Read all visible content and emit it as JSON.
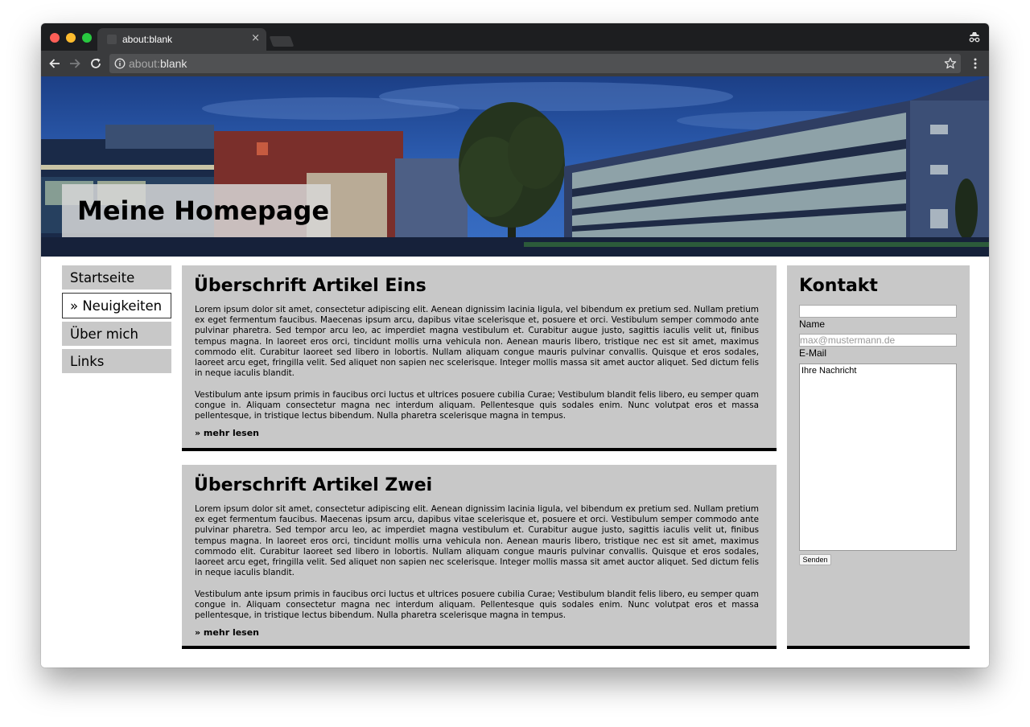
{
  "browser": {
    "tab_title": "about:blank",
    "tab_close": "×",
    "url_prefix": "about:",
    "url_rest": "blank"
  },
  "header": {
    "title": "Meine Homepage"
  },
  "nav": {
    "items": [
      {
        "label": "Startseite"
      },
      {
        "label": "» Neuigkeiten"
      },
      {
        "label": "Über mich"
      },
      {
        "label": "Links"
      }
    ]
  },
  "articles": [
    {
      "title": "Überschrift Artikel Eins",
      "paragraph1": "Lorem ipsum dolor sit amet, consectetur adipiscing elit. Aenean dignissim lacinia ligula, vel bibendum ex pretium sed. Nullam pretium ex eget fermentum faucibus. Maecenas ipsum arcu, dapibus vitae scelerisque et, posuere et orci. Vestibulum semper commodo ante pulvinar pharetra. Sed tempor arcu leo, ac imperdiet magna vestibulum et. Curabitur augue justo, sagittis iaculis velit ut, finibus tempus magna. In laoreet eros orci, tincidunt mollis urna vehicula non. Aenean mauris libero, tristique nec est sit amet, maximus commodo elit. Curabitur laoreet sed libero in lobortis. Nullam aliquam congue mauris pulvinar convallis. Quisque et eros sodales, laoreet arcu eget, fringilla velit. Sed aliquet non sapien nec scelerisque. Integer mollis massa sit amet auctor aliquet. Sed dictum felis in neque iaculis blandit.",
      "paragraph2": "Vestibulum ante ipsum primis in faucibus orci luctus et ultrices posuere cubilia Curae; Vestibulum blandit felis libero, eu semper quam congue in. Aliquam consectetur magna nec interdum aliquam. Pellentesque quis sodales enim. Nunc volutpat eros et massa pellentesque, in tristique lectus bibendum. Nulla pharetra scelerisque magna in tempus.",
      "more": "» mehr lesen"
    },
    {
      "title": "Überschrift Artikel Zwei",
      "paragraph1": "Lorem ipsum dolor sit amet, consectetur adipiscing elit. Aenean dignissim lacinia ligula, vel bibendum ex pretium sed. Nullam pretium ex eget fermentum faucibus. Maecenas ipsum arcu, dapibus vitae scelerisque et, posuere et orci. Vestibulum semper commodo ante pulvinar pharetra. Sed tempor arcu leo, ac imperdiet magna vestibulum et. Curabitur augue justo, sagittis iaculis velit ut, finibus tempus magna. In laoreet eros orci, tincidunt mollis urna vehicula non. Aenean mauris libero, tristique nec est sit amet, maximus commodo elit. Curabitur laoreet sed libero in lobortis. Nullam aliquam congue mauris pulvinar convallis. Quisque et eros sodales, laoreet arcu eget, fringilla velit. Sed aliquet non sapien nec scelerisque. Integer mollis massa sit amet auctor aliquet. Sed dictum felis in neque iaculis blandit.",
      "paragraph2": "Vestibulum ante ipsum primis in faucibus orci luctus et ultrices posuere cubilia Curae; Vestibulum blandit felis libero, eu semper quam congue in. Aliquam consectetur magna nec interdum aliquam. Pellentesque quis sodales enim. Nunc volutpat eros et massa pellentesque, in tristique lectus bibendum. Nulla pharetra scelerisque magna in tempus.",
      "more": "» mehr lesen"
    }
  ],
  "contact": {
    "title": "Kontakt",
    "name_value": "",
    "name_label": "Name",
    "email_placeholder": "max@mustermann.de",
    "email_label": "E-Mail",
    "message_value": "Ihre Nachricht",
    "submit_label": "Senden"
  },
  "colors": {
    "panel_bg": "#c8c8c8",
    "panel_border": "#000000",
    "browser_dark": "#1d1e20",
    "browser_toolbar": "#3a3b3d"
  }
}
